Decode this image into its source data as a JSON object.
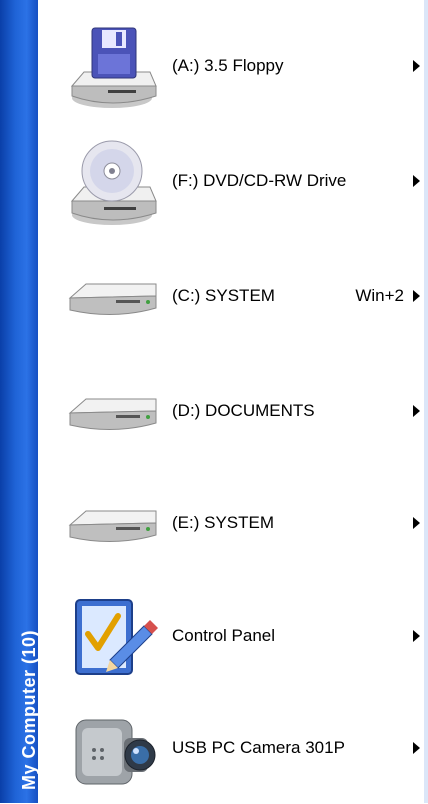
{
  "sidebar": {
    "title": "My Computer (10)"
  },
  "items": [
    {
      "label": "(A:) 3.5 Floppy",
      "shortcut": "",
      "icon": "floppy-drive-icon"
    },
    {
      "label": "(F:) DVD/CD-RW Drive",
      "shortcut": "",
      "icon": "dvd-drive-icon"
    },
    {
      "label": "(C:) SYSTEM",
      "shortcut": "Win+2",
      "icon": "hard-drive-icon"
    },
    {
      "label": "(D:) DOCUMENTS",
      "shortcut": "",
      "icon": "hard-drive-icon"
    },
    {
      "label": "(E:) SYSTEM",
      "shortcut": "",
      "icon": "hard-drive-icon"
    },
    {
      "label": "Control Panel",
      "shortcut": "",
      "icon": "control-panel-icon"
    },
    {
      "label": "USB PC Camera 301P",
      "shortcut": "",
      "icon": "camera-icon"
    }
  ],
  "colors": {
    "sidebar": "#1f63d6",
    "text": "#000000",
    "background": "#ffffff"
  }
}
